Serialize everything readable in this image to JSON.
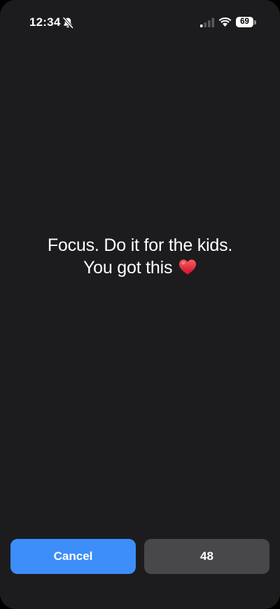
{
  "status_bar": {
    "time": "12:34",
    "battery_level": "69",
    "mute_icon": "bell-slash-icon",
    "signal_icon": "cellular-signal-icon",
    "wifi_icon": "wifi-icon"
  },
  "message": {
    "line1": "Focus. Do it for the kids.",
    "line2": "You got this",
    "emoji_icon": "red-heart-icon"
  },
  "buttons": {
    "cancel_label": "Cancel",
    "countdown_label": "48"
  },
  "colors": {
    "background": "#1c1c1e",
    "cancel_button": "#3d8ef8",
    "countdown_button": "#48484a",
    "heart": "#e3242b"
  }
}
